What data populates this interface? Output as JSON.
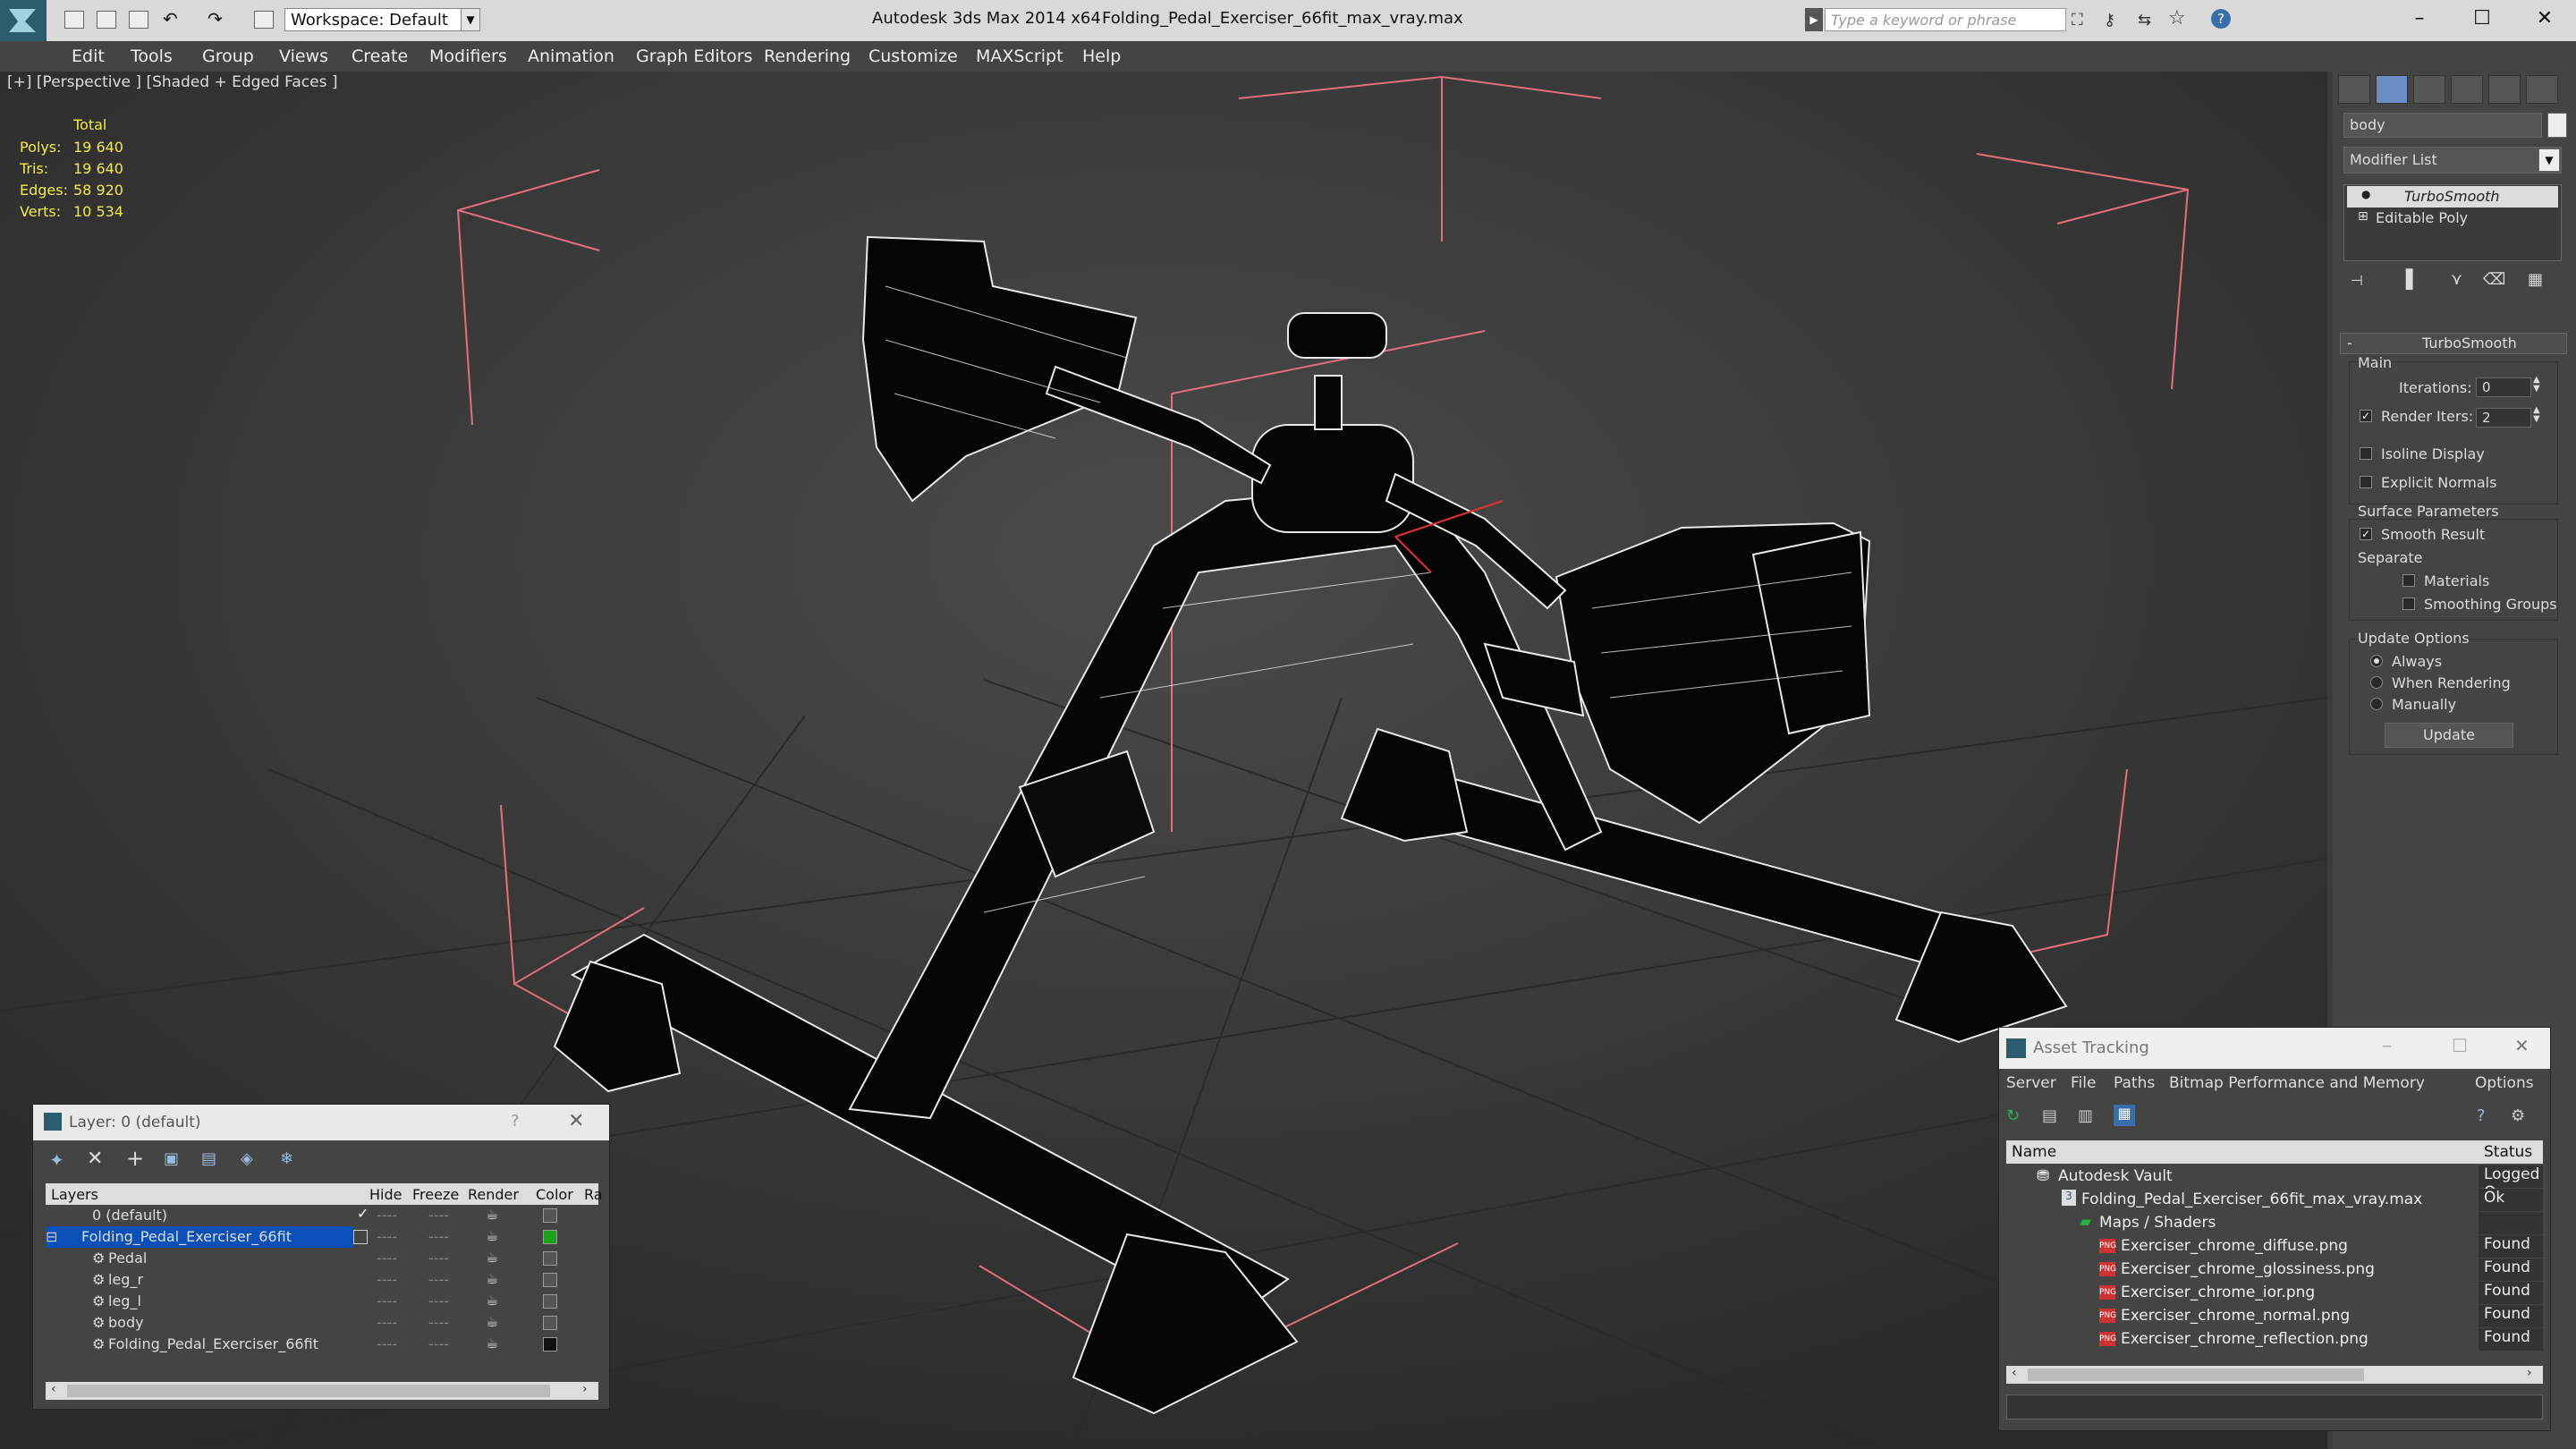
{
  "titlebar": {
    "app_title": "Autodesk 3ds Max  2014 x64",
    "file_title": "Folding_Pedal_Exerciser_66fit_max_vray.max",
    "workspace": "Workspace: Default",
    "search_placeholder": "Type a keyword or phrase"
  },
  "menu": [
    "Edit",
    "Tools",
    "Group",
    "Views",
    "Create",
    "Modifiers",
    "Animation",
    "Graph Editors",
    "Rendering",
    "Customize",
    "MAXScript",
    "Help"
  ],
  "viewport": {
    "label": "[+] [Perspective ] [Shaded + Edged Faces ]",
    "stats": {
      "header": "Total",
      "rows": [
        {
          "label": "Polys:",
          "value": "19 640"
        },
        {
          "label": "Tris:",
          "value": "19 640"
        },
        {
          "label": "Edges:",
          "value": "58 920"
        },
        {
          "label": "Verts:",
          "value": "10 534"
        }
      ]
    }
  },
  "command_panel": {
    "object_name": "body",
    "modifier_list": "Modifier List",
    "stack": [
      "TurboSmooth",
      "Editable Poly"
    ],
    "rollout_title": "TurboSmooth",
    "main_label": "Main",
    "iterations_label": "Iterations:",
    "iterations_value": "0",
    "render_iters_label": "Render Iters:",
    "render_iters_value": "2",
    "isoline": "Isoline Display",
    "explicit_normals": "Explicit Normals",
    "surface_params": "Surface Parameters",
    "smooth_result": "Smooth Result",
    "separate": "Separate",
    "materials": "Materials",
    "smoothing_groups": "Smoothing Groups",
    "update_options": "Update Options",
    "always": "Always",
    "when_rendering": "When Rendering",
    "manually": "Manually",
    "update_button": "Update"
  },
  "layer_dialog": {
    "title": "Layer: 0 (default)",
    "help": "?",
    "columns": [
      "Layers",
      "Hide",
      "Freeze",
      "Render",
      "Color",
      "Ra"
    ],
    "rows": [
      {
        "name": "0 (default)",
        "indent": 0,
        "color": "#555555"
      },
      {
        "name": "Folding_Pedal_Exerciser_66fit",
        "indent": 0,
        "color": "#1aa31a",
        "selected": true
      },
      {
        "name": "Pedal",
        "indent": 1,
        "color": "#555555"
      },
      {
        "name": "leg_r",
        "indent": 1,
        "color": "#555555"
      },
      {
        "name": "leg_l",
        "indent": 1,
        "color": "#555555"
      },
      {
        "name": "body",
        "indent": 1,
        "color": "#555555"
      },
      {
        "name": "Folding_Pedal_Exerciser_66fit",
        "indent": 1,
        "color": "#111111"
      }
    ]
  },
  "asset_tracking": {
    "title": "Asset Tracking",
    "menu": [
      "Server",
      "File",
      "Paths",
      "Bitmap Performance and Memory",
      "Options"
    ],
    "columns": [
      "Name",
      "Status"
    ],
    "rows": [
      {
        "name": "Autodesk Vault",
        "status": "Logged O",
        "indent": 0
      },
      {
        "name": "Folding_Pedal_Exerciser_66fit_max_vray.max",
        "status": "Ok",
        "indent": 1
      },
      {
        "name": "Maps / Shaders",
        "status": "",
        "indent": 2
      },
      {
        "name": "Exerciser_chrome_diffuse.png",
        "status": "Found",
        "indent": 3
      },
      {
        "name": "Exerciser_chrome_glossiness.png",
        "status": "Found",
        "indent": 3
      },
      {
        "name": "Exerciser_chrome_ior.png",
        "status": "Found",
        "indent": 3
      },
      {
        "name": "Exerciser_chrome_normal.png",
        "status": "Found",
        "indent": 3
      },
      {
        "name": "Exerciser_chrome_reflection.png",
        "status": "Found",
        "indent": 3
      }
    ]
  }
}
